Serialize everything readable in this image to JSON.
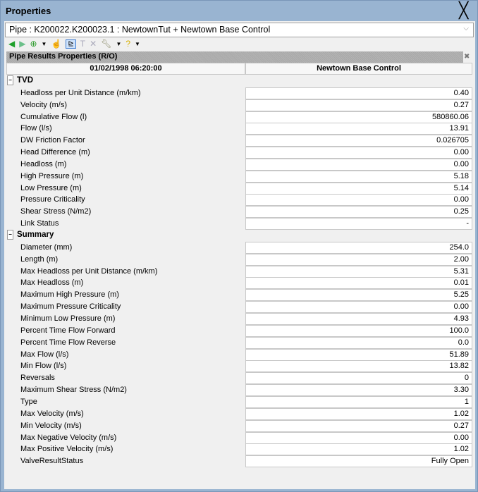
{
  "title": "Properties",
  "selector": "Pipe : K200022.K200023.1 : NewtownTut + Newtown Base Control",
  "panel_title": "Pipe Results Properties (R/O)",
  "columns": {
    "time": "01/02/1998 06:20:00",
    "scenario": "Newtown Base Control"
  },
  "groups": [
    {
      "name": "TVD",
      "rows": [
        [
          "Headloss per Unit Distance (m/km)",
          "0.40"
        ],
        [
          "Velocity (m/s)",
          "0.27"
        ],
        [
          "Cumulative Flow (l)",
          "580860.06"
        ],
        [
          "Flow (l/s)",
          "13.91"
        ],
        [
          "DW Friction Factor",
          "0.026705"
        ],
        [
          "Head Difference (m)",
          "0.00"
        ],
        [
          "Headloss (m)",
          "0.00"
        ],
        [
          "High Pressure (m)",
          "5.18"
        ],
        [
          "Low Pressure (m)",
          "5.14"
        ],
        [
          "Pressure Criticality",
          "0.00"
        ],
        [
          "Shear Stress (N/m2)",
          "0.25"
        ],
        [
          "Link Status",
          "-"
        ]
      ]
    },
    {
      "name": "Summary",
      "rows": [
        [
          "Diameter (mm)",
          "254.0"
        ],
        [
          "Length (m)",
          "2.00"
        ],
        [
          "Max Headloss per Unit Distance (m/km)",
          "5.31"
        ],
        [
          "Max Headloss (m)",
          "0.01"
        ],
        [
          "Maximum High Pressure (m)",
          "5.25"
        ],
        [
          "Maximum Pressure Criticality",
          "0.00"
        ],
        [
          "Minimum Low Pressure (m)",
          "4.93"
        ],
        [
          "Percent Time Flow Forward",
          "100.0"
        ],
        [
          "Percent Time Flow Reverse",
          "0.0"
        ],
        [
          "Max Flow (l/s)",
          "51.89"
        ],
        [
          "Min Flow (l/s)",
          "13.82"
        ],
        [
          "Reversals",
          "0"
        ],
        [
          "Maximum Shear Stress (N/m2)",
          "3.30"
        ],
        [
          "Type",
          "1"
        ],
        [
          "Max Velocity (m/s)",
          "1.02"
        ],
        [
          "Min Velocity (m/s)",
          "0.27"
        ],
        [
          "Max Negative Velocity (m/s)",
          "0.00"
        ],
        [
          "Max Positive Velocity (m/s)",
          "1.02"
        ],
        [
          "ValveResultStatus",
          "Fully Open"
        ]
      ]
    }
  ],
  "icons": {
    "collapse": "−",
    "close": "✕",
    "toolbar": [
      "back-icon",
      "forward-icon",
      "globe-icon",
      "pointer-icon",
      "graph-icon",
      "text-icon",
      "delete-icon",
      "wrench-icon",
      "help-icon"
    ]
  }
}
